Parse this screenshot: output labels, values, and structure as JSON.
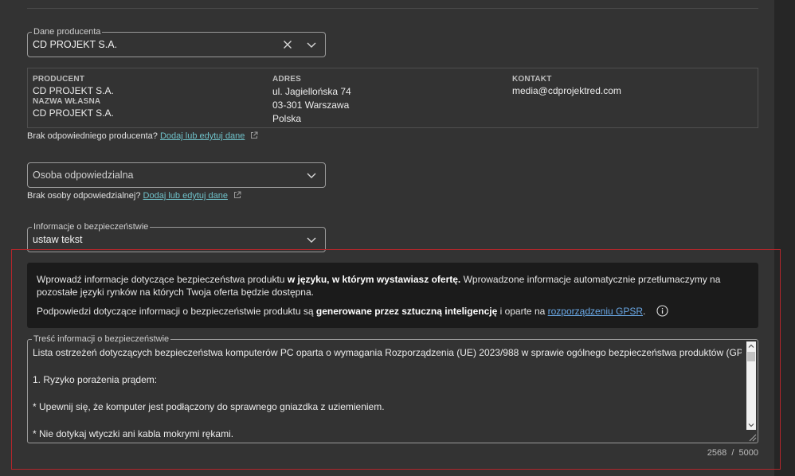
{
  "producer_field": {
    "label": "Dane producenta",
    "value": "CD PROJEKT S.A."
  },
  "producer_info": {
    "producer_label": "PRODUCENT",
    "producer_value": "CD PROJEKT S.A.",
    "own_name_label": "NAZWA WŁASNA",
    "own_name_value": "CD PROJEKT S.A.",
    "address_label": "ADRES",
    "address_lines": [
      "ul. Jagiellońska 74",
      "03-301 Warszawa",
      "Polska"
    ],
    "contact_label": "KONTAKT",
    "contact_value": "media@cdprojektred.com"
  },
  "producer_hint": {
    "text": "Brak odpowiedniego producenta?",
    "link": "Dodaj lub edytuj dane"
  },
  "responsible_field": {
    "placeholder": "Osoba odpowiedzialna"
  },
  "responsible_hint": {
    "text": "Brak osoby odpowiedzialnej?",
    "link": "Dodaj lub edytuj dane"
  },
  "safety_field": {
    "label": "Informacje o bezpieczeństwie",
    "value": "ustaw tekst"
  },
  "notice": {
    "p1_a": "Wprowadź informacje dotyczące bezpieczeństwa produktu ",
    "p1_b": "w języku, w którym wystawiasz ofertę.",
    "p1_c": " Wprowadzone informacje automatycznie przetłumaczymy na pozostałe języki rynków na których Twoja oferta będzie dostępna.",
    "p2_a": "Podpowiedzi dotyczące informacji o bezpieczeństwie produktu są ",
    "p2_b": "generowane przez sztuczną inteligencję",
    "p2_c": " i oparte na ",
    "p2_link": "rozporządzeniu GPSR",
    "p2_d": "."
  },
  "safety_text": {
    "label": "Treść informacji o bezpieczeństwie",
    "line1": "Lista ostrzeżeń dotyczących bezpieczeństwa komputerów PC oparta o wymagania Rozporządzenia (UE) 2023/988 w sprawie ogólnego bezpieczeństwa produktów (GPSR):",
    "line2": "1. Ryzyko porażenia prądem:",
    "line3": "* Upewnij się, że komputer jest podłączony do sprawnego gniazdka z uziemieniem.",
    "line4": "* Nie dotykaj wtyczki ani kabla mokrymi rękami."
  },
  "counter": {
    "current": "2568",
    "separator": "/",
    "max": "5000"
  },
  "icons": {
    "clear": "close-icon",
    "dropdown": "chevron-down-icon",
    "external": "external-link-icon",
    "info": "info-circle-icon"
  },
  "colors": {
    "link": "#6fc1c9",
    "gpsr_link": "#6aa8e6",
    "highlight_border": "#b3262b",
    "notice_bg": "#1b1b1b"
  }
}
